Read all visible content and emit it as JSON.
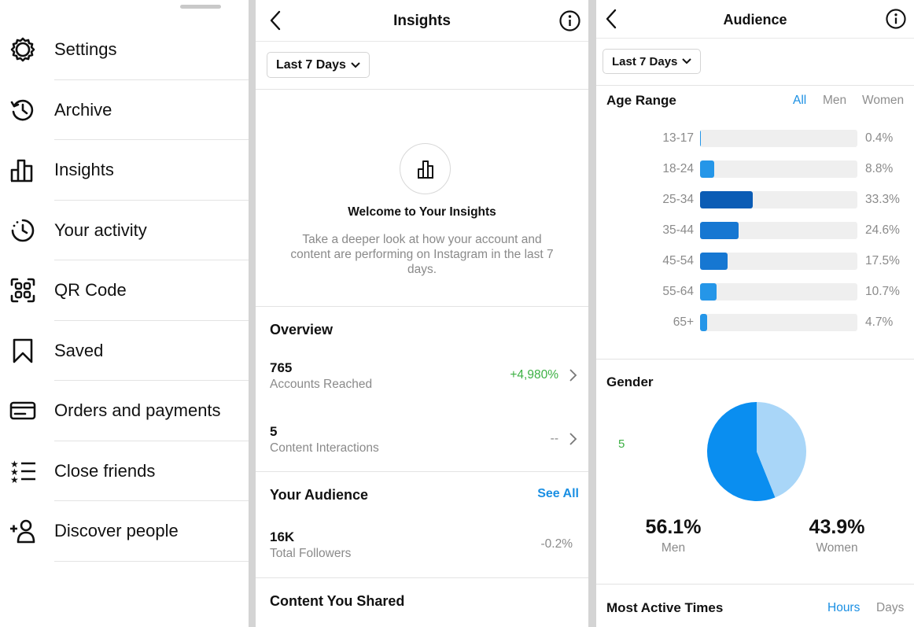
{
  "menu": {
    "items": [
      {
        "label": "Settings",
        "icon": "gear-icon"
      },
      {
        "label": "Archive",
        "icon": "archive-icon"
      },
      {
        "label": "Insights",
        "icon": "insights-icon"
      },
      {
        "label": "Your activity",
        "icon": "activity-icon"
      },
      {
        "label": "QR Code",
        "icon": "qr-code-icon"
      },
      {
        "label": "Saved",
        "icon": "bookmark-icon"
      },
      {
        "label": "Orders and payments",
        "icon": "card-icon"
      },
      {
        "label": "Close friends",
        "icon": "close-friends-icon"
      },
      {
        "label": "Discover people",
        "icon": "add-person-icon"
      }
    ]
  },
  "insights": {
    "title": "Insights",
    "date_range": "Last 7 Days",
    "welcome_title": "Welcome to Your Insights",
    "welcome_desc": "Take a deeper look at how your account and content are performing on Instagram in the last 7 days.",
    "overview_title": "Overview",
    "accounts_reached_value": "765",
    "accounts_reached_label": "Accounts Reached",
    "accounts_reached_change": "+4,980%",
    "content_interactions_value": "5",
    "content_interactions_label": "Content Interactions",
    "content_interactions_change": "--",
    "audience_title": "Your Audience",
    "see_all": "See All",
    "followers_value": "16K",
    "followers_label": "Total Followers",
    "followers_change": "-0.2%",
    "content_shared_title": "Content You Shared"
  },
  "audience": {
    "title": "Audience",
    "date_range": "Last 7 Days",
    "age_range_title": "Age Range",
    "tabs": [
      "All",
      "Men",
      "Women"
    ],
    "active_tab": "All",
    "age_groups": [
      {
        "label": "13-17",
        "pct": "0.4%",
        "value": 0.4
      },
      {
        "label": "18-24",
        "pct": "8.8%",
        "value": 8.8
      },
      {
        "label": "25-34",
        "pct": "33.3%",
        "value": 33.3
      },
      {
        "label": "35-44",
        "pct": "24.6%",
        "value": 24.6
      },
      {
        "label": "45-54",
        "pct": "17.5%",
        "value": 17.5
      },
      {
        "label": "55-64",
        "pct": "10.7%",
        "value": 10.7
      },
      {
        "label": "65+",
        "pct": "4.7%",
        "value": 4.7
      }
    ],
    "gender_title": "Gender",
    "gender_side_note": "5",
    "men_pct": "56.1%",
    "men_label": "Men",
    "women_pct": "43.9%",
    "women_label": "Women",
    "most_active_title": "Most Active Times",
    "time_tabs": [
      "Hours",
      "Days"
    ],
    "active_time_tab": "Hours"
  },
  "colors": {
    "accent_blue": "#1a8fe3",
    "bar_dark": "#0b5cb5",
    "bar_mid": "#1677d2",
    "bar_light": "#2596e8",
    "pie_men": "#0a8ef0",
    "pie_women": "#a9d6f8",
    "positive": "#3cb043"
  },
  "chart_data": {
    "type": "pie",
    "title": "Gender",
    "categories": [
      "Men",
      "Women"
    ],
    "values": [
      56.1,
      43.9
    ]
  }
}
